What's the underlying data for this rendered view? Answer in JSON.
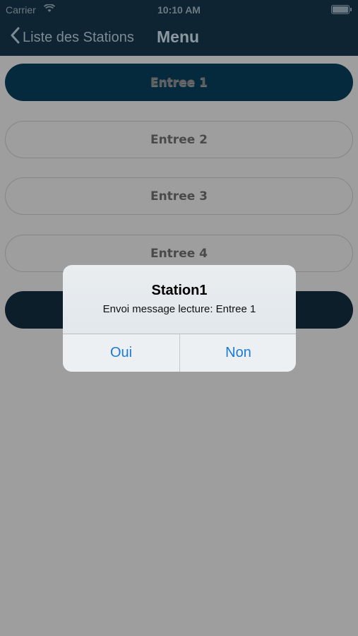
{
  "status_bar": {
    "carrier": "Carrier",
    "time": "10:10 AM"
  },
  "nav": {
    "back_label": "Liste des Stations",
    "title": "Menu"
  },
  "entries": [
    {
      "label": "Entree 1"
    },
    {
      "label": "Entree 2"
    },
    {
      "label": "Entree 3"
    },
    {
      "label": "Entree 4"
    },
    {
      "label": ""
    }
  ],
  "dialog": {
    "title": "Station1",
    "message": "Envoi message lecture: Entree 1",
    "yes_label": "Oui",
    "no_label": "Non"
  },
  "colors": {
    "nav_bg": "#0f2432",
    "selected_button": "#062a3d",
    "dialog_button_text": "#1a7bd8",
    "overlay": "#9e9e9e"
  }
}
